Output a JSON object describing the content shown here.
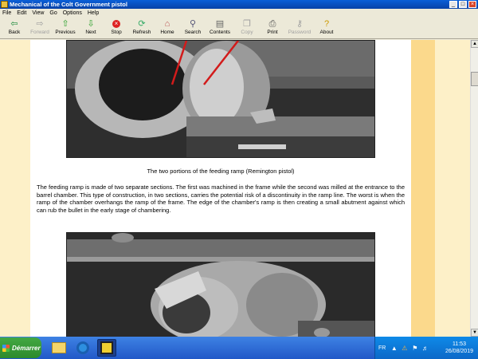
{
  "window": {
    "title": "Mechanical of the Colt Government pistol"
  },
  "menu": [
    "File",
    "Edit",
    "View",
    "Go",
    "Options",
    "Help"
  ],
  "toolbar": [
    {
      "name": "back",
      "label": "Back",
      "icon": "arrow-left-icon",
      "enabled": true
    },
    {
      "name": "forward",
      "label": "Forward",
      "icon": "arrow-right-icon",
      "enabled": false
    },
    {
      "name": "previous",
      "label": "Previous",
      "icon": "arrow-up-icon",
      "enabled": true
    },
    {
      "name": "next",
      "label": "Next",
      "icon": "arrow-down-icon",
      "enabled": true
    },
    {
      "name": "stop",
      "label": "Stop",
      "icon": "stop-icon",
      "enabled": true
    },
    {
      "name": "refresh",
      "label": "Refresh",
      "icon": "refresh-icon",
      "enabled": true
    },
    {
      "name": "home",
      "label": "Home",
      "icon": "home-icon",
      "enabled": true
    },
    {
      "name": "search",
      "label": "Search",
      "icon": "search-icon",
      "enabled": true
    },
    {
      "name": "contents",
      "label": "Contents",
      "icon": "contents-icon",
      "enabled": true
    },
    {
      "name": "copy",
      "label": "Copy",
      "icon": "copy-icon",
      "enabled": false
    },
    {
      "name": "print",
      "label": "Print",
      "icon": "print-icon",
      "enabled": true
    },
    {
      "name": "password",
      "label": "Password",
      "icon": "key-icon",
      "enabled": false
    },
    {
      "name": "about",
      "label": "About",
      "icon": "about-icon",
      "enabled": true
    }
  ],
  "article": {
    "caption": "The two portions of the feeding ramp (Remington pistol)",
    "paragraph": "The feeding ramp is made of two separate sections. The first was machined in the frame while the second was milled at the entrance to the barrel chamber. This type of construction, in two sections, carries the potential risk of a discontinuity in the ramp line. The worst is when the ramp of the chamber overhangs the ramp of the frame. The edge of the chamber's ramp is then creating a small abutment against which can rub the bullet in the early stage of chambering."
  },
  "taskbar": {
    "start_label": "Démarrer",
    "language": "FR",
    "time": "11:53",
    "date": "26/08/2019"
  },
  "colors": {
    "titlebar": "#0a5fd8",
    "page_background": "#fdf0c8",
    "accent_stripe": "#fbd98c",
    "taskbar": "#2158c8"
  }
}
